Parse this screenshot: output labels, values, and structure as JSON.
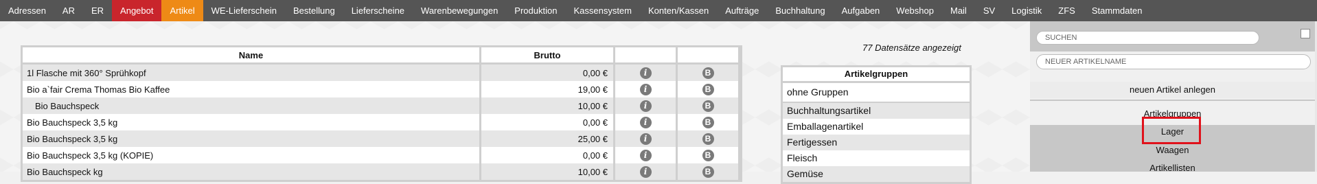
{
  "nav": {
    "items": [
      {
        "label": "Adressen",
        "state": ""
      },
      {
        "label": "AR",
        "state": ""
      },
      {
        "label": "ER",
        "state": ""
      },
      {
        "label": "Angebot",
        "state": "red"
      },
      {
        "label": "Artikel",
        "state": "orange"
      },
      {
        "label": "WE-Lieferschein",
        "state": ""
      },
      {
        "label": "Bestellung",
        "state": ""
      },
      {
        "label": "Lieferscheine",
        "state": ""
      },
      {
        "label": "Warenbewegungen",
        "state": ""
      },
      {
        "label": "Produktion",
        "state": ""
      },
      {
        "label": "Kassensystem",
        "state": ""
      },
      {
        "label": "Konten/Kassen",
        "state": ""
      },
      {
        "label": "Aufträge",
        "state": ""
      },
      {
        "label": "Buchhaltung",
        "state": ""
      },
      {
        "label": "Aufgaben",
        "state": ""
      },
      {
        "label": "Webshop",
        "state": ""
      },
      {
        "label": "Mail",
        "state": ""
      },
      {
        "label": "SV",
        "state": ""
      },
      {
        "label": "Logistik",
        "state": ""
      },
      {
        "label": "ZFS",
        "state": ""
      },
      {
        "label": "Stammdaten",
        "state": ""
      }
    ]
  },
  "table": {
    "headers": {
      "name": "Name",
      "brutto": "Brutto"
    },
    "rows": [
      {
        "name": "1l Flasche mit 360° Sprühkopf",
        "brutto": "0,00 €",
        "indent": false
      },
      {
        "name": "Bio a`fair Crema Thomas Bio Kaffee",
        "brutto": "19,00 €",
        "indent": false
      },
      {
        "name": "Bio Bauchspeck",
        "brutto": "10,00 €",
        "indent": true
      },
      {
        "name": "Bio Bauchspeck 3,5 kg",
        "brutto": "0,00 €",
        "indent": false
      },
      {
        "name": "Bio Bauchspeck 3,5 kg",
        "brutto": "25,00 €",
        "indent": false
      },
      {
        "name": "Bio Bauchspeck 3,5 kg (KOPIE)",
        "brutto": "0,00 €",
        "indent": false
      },
      {
        "name": "Bio Bauchspeck kg",
        "brutto": "10,00 €",
        "indent": false
      }
    ],
    "info_icon": "i",
    "b_icon": "B"
  },
  "count_text": "77 Datensätze angezeigt",
  "groups": {
    "header": "Artikelgruppen",
    "items": [
      "ohne Gruppen",
      "Buchhaltungsartikel",
      "Emballagenartikel",
      "Fertigessen",
      "Fleisch",
      "Gemüse"
    ]
  },
  "panel": {
    "search_placeholder": "SUCHEN",
    "newname_placeholder": "NEUER ARTIKELNAME",
    "new_button": "neuen Artikel anlegen",
    "menu": [
      "Artikelgruppen",
      "Lager",
      "Waagen",
      "Artikellisten"
    ]
  },
  "colors": {
    "nav_bg": "#555555",
    "active_red": "#c9252c",
    "active_orange": "#ee8a16",
    "highlight": "#e0121b"
  }
}
